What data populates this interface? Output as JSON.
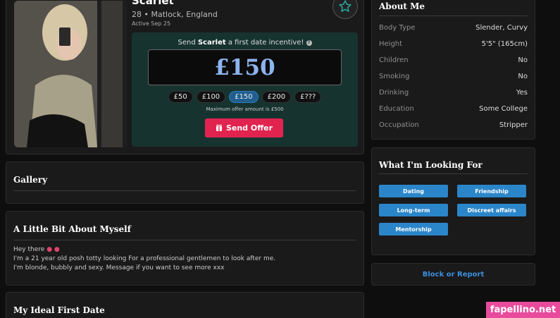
{
  "profile": {
    "name": "Scarlet",
    "location": "28 • Matlock, England",
    "active": "Active Sep 25"
  },
  "offer": {
    "prompt_pre": "Send ",
    "prompt_name": "Scarlet",
    "prompt_post": " a first date incentive!",
    "amount": "£150",
    "chips": [
      "£50",
      "£100",
      "£150",
      "£200",
      "£???"
    ],
    "selected_index": 2,
    "max_note": "Maximum offer amount is £500",
    "send_label": "Send Offer"
  },
  "gallery": {
    "title": "Gallery"
  },
  "about_self": {
    "title": "A Little Bit About Myself",
    "line1": "Hey there",
    "line2": "I'm a 21 year old posh totty looking For a professional gentlemen to look after me.",
    "line3": "I'm blonde, bubbly and sexy. Message if you want to see more xxx"
  },
  "first_date": {
    "title": "My Ideal First Date"
  },
  "about_me": {
    "title": "About Me",
    "rows": [
      {
        "label": "Body Type",
        "value": "Slender, Curvy"
      },
      {
        "label": "Height",
        "value": "5'5\" (165cm)"
      },
      {
        "label": "Children",
        "value": "No"
      },
      {
        "label": "Smoking",
        "value": "No"
      },
      {
        "label": "Drinking",
        "value": "Yes"
      },
      {
        "label": "Education",
        "value": "Some College"
      },
      {
        "label": "Occupation",
        "value": "Stripper"
      }
    ]
  },
  "looking_for": {
    "title": "What I'm Looking For",
    "tags": [
      "Dating",
      "Friendship",
      "Long-term",
      "Discreet affairs",
      "Mentorship"
    ]
  },
  "block_label": "Block or Report",
  "watermark": "fapellino.net",
  "colors": {
    "accent_blue": "#2b86c9",
    "send_red": "#e0244f",
    "offer_bg": "#173330",
    "amount_blue": "#8cb4ee",
    "watermark_pink": "#e84b9c"
  },
  "icons": {
    "favorite": "star-outline-icon",
    "help": "question-circle-icon",
    "send": "gift-icon"
  }
}
